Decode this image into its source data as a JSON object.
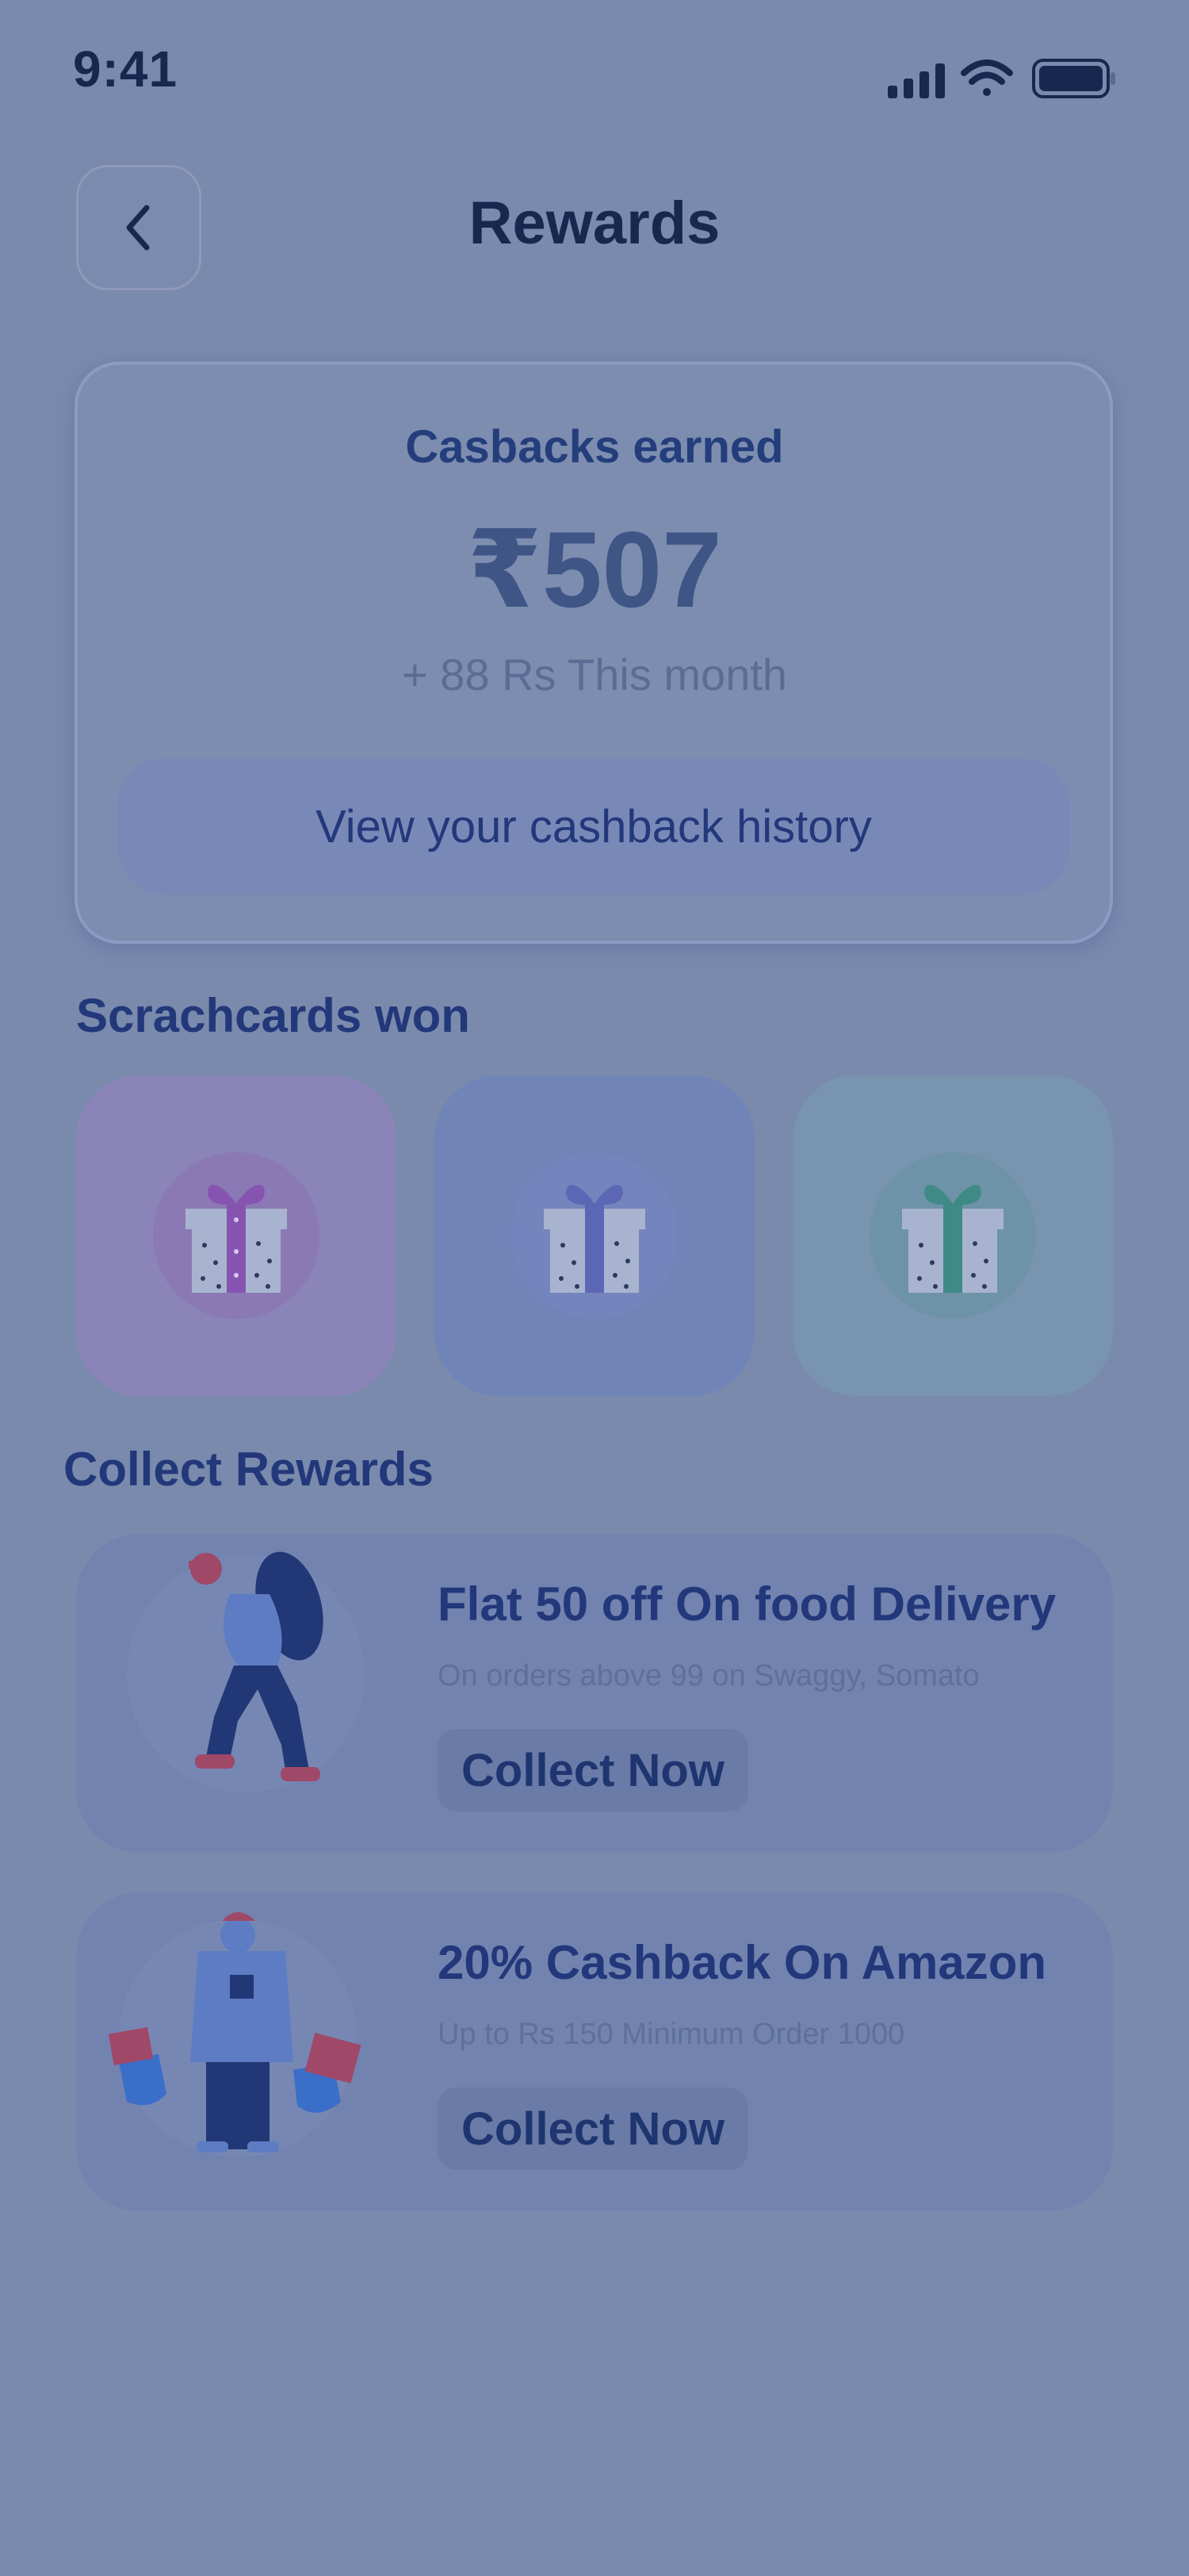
{
  "status_bar": {
    "time": "9:41"
  },
  "header": {
    "title": "Rewards",
    "back_icon": "chevron-left-icon"
  },
  "cashback": {
    "title": "Casbacks earned",
    "amount": "₹507",
    "month_text": "+ 88 Rs This month",
    "history_button": "View your cashback history"
  },
  "scratchcards": {
    "heading": "Scrachcards won",
    "cards": [
      {
        "icon": "gift-icon",
        "bg": "#8a84b8",
        "circle": "#8a79b4",
        "ribbon": "#8753b0"
      },
      {
        "icon": "gift-icon",
        "bg": "#7184b8",
        "circle": "#7484bc",
        "ribbon": "#5b67b5"
      },
      {
        "icon": "gift-icon",
        "bg": "#7894ae",
        "circle": "#6e92a8",
        "ribbon": "#3f8a86"
      }
    ]
  },
  "collect": {
    "heading": "Collect Rewards",
    "rewards": [
      {
        "title": "Flat 50 off On food Delivery",
        "subtitle": "On orders above 99 on Swaggy, Somato",
        "button": "Collect Now",
        "illustration": "delivery-person-illustration"
      },
      {
        "title": "20% Cashback On Amazon",
        "subtitle": "Up to Rs 150 Minimum Order 1000",
        "button": "Collect Now",
        "illustration": "shopper-illustration"
      }
    ]
  }
}
